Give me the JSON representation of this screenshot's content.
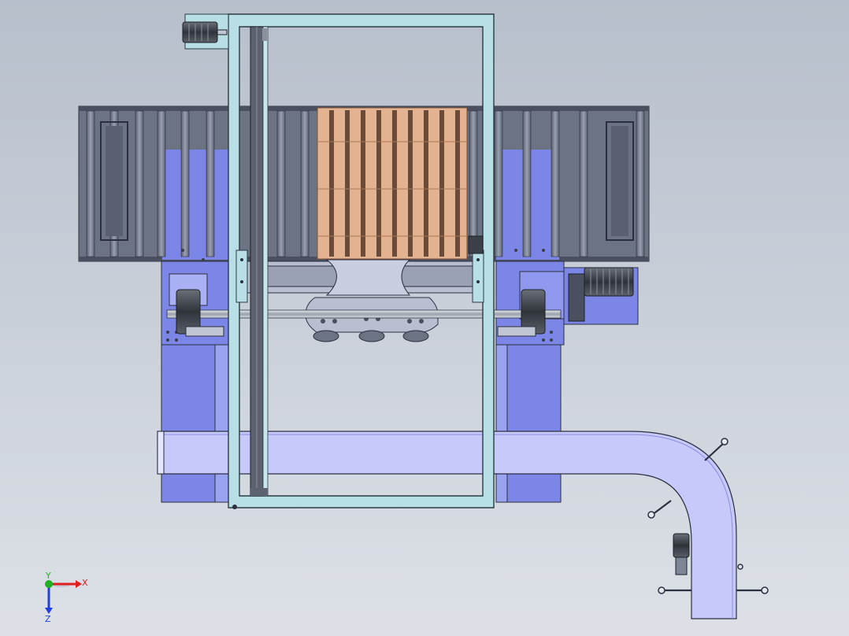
{
  "viewport": {
    "background_top": "#b7bfcc",
    "background_bottom": "#dde1e7"
  },
  "colors": {
    "frame_fill": "#b9dfe6",
    "frame_stroke": "#2b3a42",
    "base_blue": "#7c86e6",
    "base_blue_light": "#9aa3f0",
    "conveyor_blue": "#c7c9fb",
    "conveyor_blue_dark": "#a9acef",
    "roller_gray": "#7d8596",
    "roller_dark": "#4a5060",
    "pallet_wood": "#e2b291",
    "pallet_wood_dark": "#a87858",
    "shaft_gray": "#bcc2cc",
    "motor_dark": "#3c4048",
    "carriage_gray": "#b9bfd0",
    "belt_dark": "#5c6270"
  },
  "axis_triad": {
    "x_label": "X",
    "y_label": "Y",
    "z_label": "Z",
    "x_color": "#e02020",
    "y_color": "#20b020",
    "z_color": "#2040e0"
  }
}
